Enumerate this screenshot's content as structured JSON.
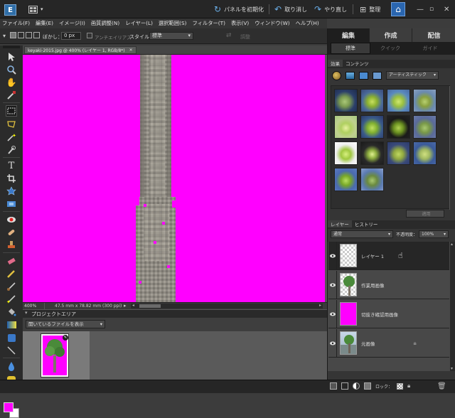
{
  "titlebar": {
    "reset_panels": "パネルを初期化",
    "undo": "取り消し",
    "redo": "やり直し",
    "organize": "整理"
  },
  "menubar": {
    "items": [
      "ファイル(F)",
      "編集(E)",
      "イメージ(I)",
      "画質調整(N)",
      "レイヤー(L)",
      "選択範囲(S)",
      "フィルター(T)",
      "表示(V)",
      "ウィンドウ(W)",
      "ヘルプ(H)"
    ]
  },
  "options": {
    "feather_label": "ぼかし：",
    "feather_value": "0 px",
    "antialias_label": "アンチエイリアス",
    "style_label": "スタイル：",
    "style_value": "標準",
    "refine_label": "調整"
  },
  "document": {
    "tab_title": "keyaki-2015.jpg @ 400% (レイヤー 1, RGB/8*)",
    "zoom": "400%",
    "status_info": "47.5 mm x 78.82 mm (300 ppi)"
  },
  "project": {
    "title": "プロジェクトエリア",
    "dropdown": "開いているファイルを表示"
  },
  "right_panel": {
    "main_tabs": [
      "編集",
      "作成",
      "配信"
    ],
    "sub_tabs": [
      "標準",
      "クイック",
      "ガイド"
    ],
    "effects_tabs": [
      "効果",
      "コンテンツ"
    ],
    "effects_filter": "アーティスティック",
    "apply_button": "適用",
    "layers_tabs": [
      "レイヤー",
      "ヒストリー"
    ],
    "blend_mode": "通常",
    "opacity_label": "不透明度：",
    "opacity_value": "100%",
    "layers": [
      "レイヤー 1",
      "作業用画像",
      "切抜き確認用画像",
      "元画像"
    ],
    "lock_label": "ロック："
  },
  "colors": {
    "canvas": "#ff00ff",
    "foreground": "#ff00ff",
    "background": "#ffffff",
    "accent_tab": "#1e1e1e"
  }
}
